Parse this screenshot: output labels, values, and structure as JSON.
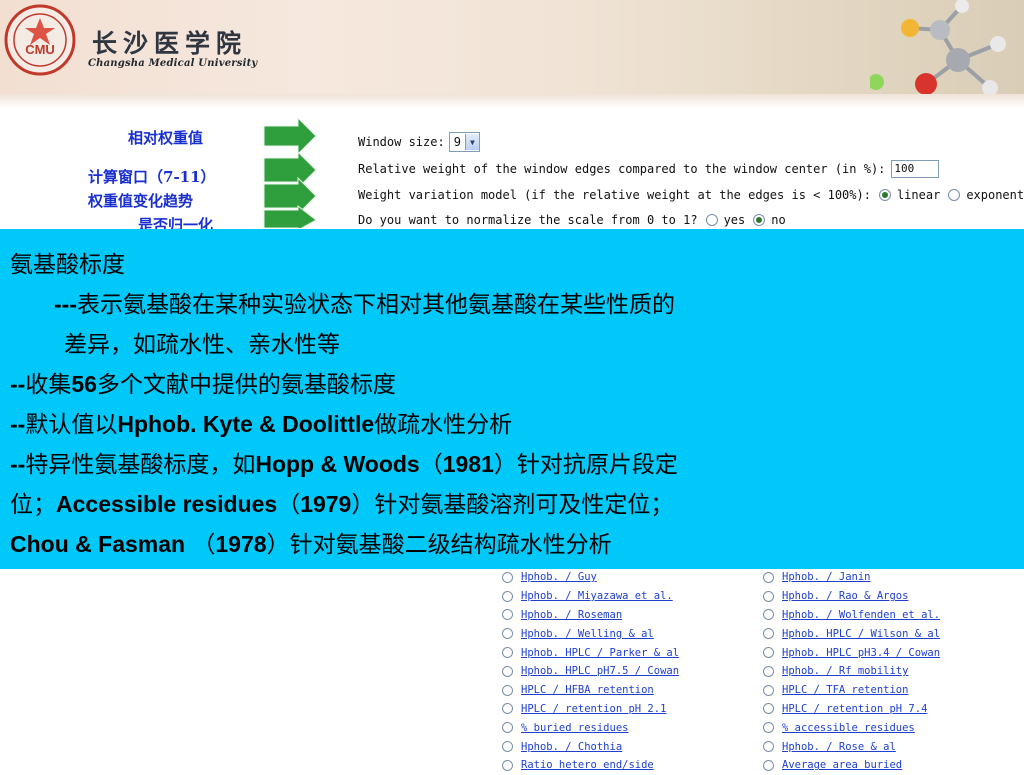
{
  "header": {
    "university_cn": "长沙医学院",
    "university_en": "Changsha Medical University"
  },
  "labels": {
    "relative_weight": "相对权重值",
    "window": "计算窗口（7-11）",
    "weight_trend": "权重值变化趋势",
    "normalize": "是否归一化"
  },
  "form": {
    "window_size_label": "Window size:",
    "window_size_value": "9",
    "relative_weight_label": "Relative weight of the window edges compared to the window center (in %):",
    "relative_weight_value": "100",
    "variation_label": "Weight variation model (if the relative weight at the edges is < 100%):",
    "variation_opt1": "linear",
    "variation_opt2": "exponential",
    "variation_selected": "linear",
    "normalize_label": "Do you want to normalize the scale from 0 to 1?",
    "normalize_opt1": "yes",
    "normalize_opt2": "no",
    "normalize_selected": "no"
  },
  "overlay": {
    "line1": "氨基酸标度",
    "line2_prefix": "---",
    "line2": "表示氨基酸在某种实验状态下相对其他氨基酸在某些性质的",
    "line3": "差异，如疏水性、亲水性等",
    "line4_prefix": "--",
    "line4_a": "收集",
    "line4_num": "56",
    "line4_b": "多个文献中提供的氨基酸标度",
    "line5_prefix": "--",
    "line5_a": "默认值以",
    "line5_bold": "Hphob. Kyte & Doolittle",
    "line5_b": "做疏水性分析",
    "line6_prefix": "--",
    "line6_a": "特异性氨基酸标度，如",
    "line6_bold": "Hopp & Woods",
    "line6_b": "（",
    "line6_year": "1981",
    "line6_c": "）针对抗原片段定",
    "line7_a": "位；",
    "line7_bold": "Accessible residues",
    "line7_b": "（",
    "line7_year": "1979",
    "line7_c": "）针对氨基酸溶剂可及性定位；",
    "line8_bold": "Chou & Fasman",
    "line8_b": " （",
    "line8_year": "1978",
    "line8_c": "）针对氨基酸二级结构疏水性分析"
  },
  "scales": {
    "left": [
      "Hphob. / Guy",
      "Hphob. / Miyazawa et al.",
      "Hphob. / Roseman",
      "Hphob. / Welling & al",
      "Hphob. HPLC / Parker & al",
      "Hphob. HPLC pH7.5 / Cowan",
      "HPLC / HFBA retention",
      "HPLC / retention pH 2.1",
      "% buried residues",
      "Hphob. / Chothia",
      "Ratio hetero end/side"
    ],
    "right": [
      "Hphob. / Janin",
      "Hphob. / Rao & Argos",
      "Hphob. / Wolfenden et al.",
      "Hphob. HPLC / Wilson & al",
      "Hphob. HPLC pH3.4 / Cowan",
      "Hphob. / Rf mobility",
      "HPLC / TFA retention",
      "HPLC / retention pH 7.4",
      "% accessible residues",
      "Hphob. / Rose & al",
      "Average area buried"
    ]
  },
  "colors": {
    "overlay_bg": "#00c8f8",
    "label_blue": "#1a2fd0",
    "arrow_green": "#2f9e3c",
    "link_blue": "#1f3fd0"
  }
}
